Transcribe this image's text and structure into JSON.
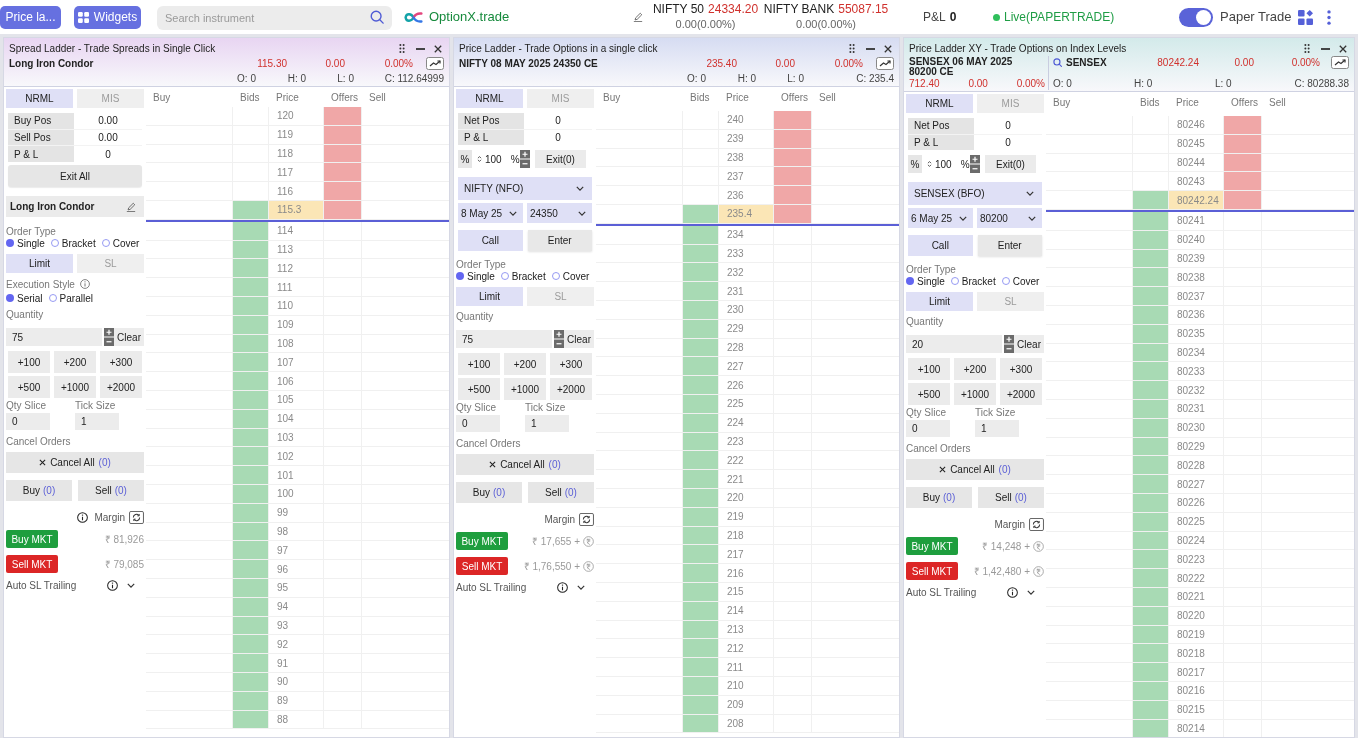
{
  "top_bar": {
    "menu_button": "Price la...",
    "widgets_button": "Widgets",
    "search": {
      "placeholder": "Search instrument"
    },
    "logo": "OptionX.trade",
    "indices": [
      {
        "name": "NIFTY 50",
        "value": "24334.20",
        "change": "0.00(0.00%)"
      },
      {
        "name": "NIFTY BANK",
        "value": "55087.15",
        "change": "0.00(0.00%)"
      }
    ],
    "pnl": {
      "label": "P&L",
      "value": "0"
    },
    "status": "Live(PAPERTRADE)",
    "paper_trade": {
      "label": "Paper Trade",
      "on": true
    }
  },
  "panels": [
    {
      "kind": "spread",
      "color": "#e8d5f2",
      "title": "Spread Ladder - Trade Spreads in Single Click",
      "quote": {
        "name": "Long Iron Condor",
        "ltp": "115.30",
        "change": "0.00",
        "change_pct": "0.00%"
      },
      "stats": [
        "O: 0",
        "H: 0",
        "L: 0",
        "C: 112.64999"
      ],
      "product_tabs": [
        {
          "label": "NRML",
          "selected": true
        },
        {
          "label": "MIS",
          "selected": false
        }
      ],
      "positions": [
        {
          "label": "Buy Pos",
          "value": "0.00"
        },
        {
          "label": "Sell Pos",
          "value": "0.00"
        },
        {
          "label": "P & L",
          "value": "0"
        }
      ],
      "exit_all": "Exit All",
      "strategy": "Long Iron Condor",
      "order_type": {
        "label": "Order Type",
        "options": [
          {
            "label": "Single",
            "selected": true
          },
          {
            "label": "Bracket",
            "selected": false
          },
          {
            "label": "Cover",
            "selected": false
          }
        ]
      },
      "price_tabs": [
        {
          "label": "Limit",
          "selected": true
        },
        {
          "label": "SL",
          "selected": false
        }
      ],
      "execution_style": {
        "label": "Execution Style",
        "options": [
          {
            "label": "Serial",
            "selected": true
          },
          {
            "label": "Parallel",
            "selected": false
          }
        ]
      },
      "quantity": {
        "label": "Quantity",
        "value": "75",
        "clear": "Clear"
      },
      "presets": [
        "+100",
        "+200",
        "+300",
        "+500",
        "+1000",
        "+2000"
      ],
      "qty_slice": {
        "label": "Qty Slice",
        "value": "0"
      },
      "tick_size": {
        "label": "Tick Size",
        "value": "1"
      },
      "cancel_orders": {
        "label": "Cancel Orders",
        "button": "Cancel All",
        "count": "(0)"
      },
      "order_counts": [
        {
          "label": "Buy",
          "count": "(0)"
        },
        {
          "label": "Sell",
          "count": "(0)"
        }
      ],
      "margin": "Margin",
      "market_orders": [
        {
          "kind": "buy",
          "label": "Buy MKT",
          "margin": "₹ 81,926"
        },
        {
          "kind": "sell",
          "label": "Sell MKT",
          "margin": "₹ 79,085"
        }
      ],
      "auto_sl": {
        "label": "Auto SL Trailing",
        "expanded": false
      },
      "ladder": {
        "columns": [
          "Buy",
          "Bids",
          "Price",
          "Offers",
          "Sell"
        ],
        "rows": [
          {
            "price": "120",
            "bid": false,
            "offer": true,
            "current": false
          },
          {
            "price": "119",
            "bid": false,
            "offer": true,
            "current": false
          },
          {
            "price": "118",
            "bid": false,
            "offer": true,
            "current": false
          },
          {
            "price": "117",
            "bid": false,
            "offer": true,
            "current": false
          },
          {
            "price": "116",
            "bid": false,
            "offer": true,
            "current": false
          },
          {
            "price": "115.3",
            "bid": true,
            "offer": true,
            "current": true
          },
          {
            "price": "114",
            "bid": true,
            "offer": false,
            "current": false
          },
          {
            "price": "113",
            "bid": true,
            "offer": false,
            "current": false
          },
          {
            "price": "112",
            "bid": true,
            "offer": false,
            "current": false
          },
          {
            "price": "111",
            "bid": true,
            "offer": false,
            "current": false
          },
          {
            "price": "110",
            "bid": true,
            "offer": false,
            "current": false
          },
          {
            "price": "109",
            "bid": true,
            "offer": false,
            "current": false
          },
          {
            "price": "108",
            "bid": true,
            "offer": false,
            "current": false
          },
          {
            "price": "107",
            "bid": true,
            "offer": false,
            "current": false
          },
          {
            "price": "106",
            "bid": true,
            "offer": false,
            "current": false
          },
          {
            "price": "105",
            "bid": true,
            "offer": false,
            "current": false
          },
          {
            "price": "104",
            "bid": true,
            "offer": false,
            "current": false
          },
          {
            "price": "103",
            "bid": true,
            "offer": false,
            "current": false
          },
          {
            "price": "102",
            "bid": true,
            "offer": false,
            "current": false
          },
          {
            "price": "101",
            "bid": true,
            "offer": false,
            "current": false
          },
          {
            "price": "100",
            "bid": true,
            "offer": false,
            "current": false
          },
          {
            "price": "99",
            "bid": true,
            "offer": false,
            "current": false
          },
          {
            "price": "98",
            "bid": true,
            "offer": false,
            "current": false
          },
          {
            "price": "97",
            "bid": true,
            "offer": false,
            "current": false
          },
          {
            "price": "96",
            "bid": true,
            "offer": false,
            "current": false
          },
          {
            "price": "95",
            "bid": true,
            "offer": false,
            "current": false
          },
          {
            "price": "94",
            "bid": true,
            "offer": false,
            "current": false
          },
          {
            "price": "93",
            "bid": true,
            "offer": false,
            "current": false
          },
          {
            "price": "92",
            "bid": true,
            "offer": false,
            "current": false
          },
          {
            "price": "91",
            "bid": true,
            "offer": false,
            "current": false
          },
          {
            "price": "90",
            "bid": true,
            "offer": false,
            "current": false
          },
          {
            "price": "89",
            "bid": true,
            "offer": false,
            "current": false
          },
          {
            "price": "88",
            "bid": true,
            "offer": false,
            "current": false
          }
        ]
      }
    },
    {
      "kind": "option",
      "color": "#d6dcf2",
      "title": "Price Ladder - Trade Options in a single click",
      "quote": {
        "name": "NIFTY 08 MAY 2025 24350 CE",
        "ltp": "235.40",
        "change": "0.00",
        "change_pct": "0.00%"
      },
      "stats": [
        "O: 0",
        "H: 0",
        "L: 0",
        "C: 235.4"
      ],
      "product_tabs": [
        {
          "label": "NRML",
          "selected": true
        },
        {
          "label": "MIS",
          "selected": false
        }
      ],
      "positions": [
        {
          "label": "Net Pos",
          "value": "0"
        },
        {
          "label": "P & L",
          "value": "0"
        }
      ],
      "exit_row": {
        "prefix": "%",
        "value": "100",
        "suffix": "%",
        "button": "Exit(0)"
      },
      "instrument": "NIFTY (NFO)",
      "expiry": "8 May 25",
      "strike": "24350",
      "call_button": "Call",
      "enter_button": "Enter",
      "order_type": {
        "label": "Order Type",
        "options": [
          {
            "label": "Single",
            "selected": true
          },
          {
            "label": "Bracket",
            "selected": false
          },
          {
            "label": "Cover",
            "selected": false
          }
        ]
      },
      "price_tabs": [
        {
          "label": "Limit",
          "selected": true
        },
        {
          "label": "SL",
          "selected": false
        }
      ],
      "quantity": {
        "label": "Quantity",
        "value": "75",
        "clear": "Clear"
      },
      "presets": [
        "+100",
        "+200",
        "+300",
        "+500",
        "+1000",
        "+2000"
      ],
      "qty_slice": {
        "label": "Qty Slice",
        "value": "0"
      },
      "tick_size": {
        "label": "Tick Size",
        "value": "1"
      },
      "cancel_orders": {
        "label": "Cancel Orders",
        "button": "Cancel All",
        "count": "(0)"
      },
      "order_counts": [
        {
          "label": "Buy",
          "count": "(0)"
        },
        {
          "label": "Sell",
          "count": "(0)"
        }
      ],
      "margin": "Margin",
      "market_orders": [
        {
          "kind": "buy",
          "label": "Buy MKT",
          "margin": "₹ 17,655 +"
        },
        {
          "kind": "sell",
          "label": "Sell MKT",
          "margin": "₹ 1,76,550 +"
        }
      ],
      "auto_sl": {
        "label": "Auto SL Trailing",
        "expanded": false
      },
      "ladder": {
        "columns": [
          "Buy",
          "Bids",
          "Price",
          "Offers",
          "Sell"
        ],
        "rows": [
          {
            "price": "240",
            "bid": false,
            "offer": true,
            "current": false
          },
          {
            "price": "239",
            "bid": false,
            "offer": true,
            "current": false
          },
          {
            "price": "238",
            "bid": false,
            "offer": true,
            "current": false
          },
          {
            "price": "237",
            "bid": false,
            "offer": true,
            "current": false
          },
          {
            "price": "236",
            "bid": false,
            "offer": true,
            "current": false
          },
          {
            "price": "235.4",
            "bid": true,
            "offer": true,
            "current": true
          },
          {
            "price": "234",
            "bid": true,
            "offer": false,
            "current": false
          },
          {
            "price": "233",
            "bid": true,
            "offer": false,
            "current": false
          },
          {
            "price": "232",
            "bid": true,
            "offer": false,
            "current": false
          },
          {
            "price": "231",
            "bid": true,
            "offer": false,
            "current": false
          },
          {
            "price": "230",
            "bid": true,
            "offer": false,
            "current": false
          },
          {
            "price": "229",
            "bid": true,
            "offer": false,
            "current": false
          },
          {
            "price": "228",
            "bid": true,
            "offer": false,
            "current": false
          },
          {
            "price": "227",
            "bid": true,
            "offer": false,
            "current": false
          },
          {
            "price": "226",
            "bid": true,
            "offer": false,
            "current": false
          },
          {
            "price": "225",
            "bid": true,
            "offer": false,
            "current": false
          },
          {
            "price": "224",
            "bid": true,
            "offer": false,
            "current": false
          },
          {
            "price": "223",
            "bid": true,
            "offer": false,
            "current": false
          },
          {
            "price": "222",
            "bid": true,
            "offer": false,
            "current": false
          },
          {
            "price": "221",
            "bid": true,
            "offer": false,
            "current": false
          },
          {
            "price": "220",
            "bid": true,
            "offer": false,
            "current": false
          },
          {
            "price": "219",
            "bid": true,
            "offer": false,
            "current": false
          },
          {
            "price": "218",
            "bid": true,
            "offer": false,
            "current": false
          },
          {
            "price": "217",
            "bid": true,
            "offer": false,
            "current": false
          },
          {
            "price": "216",
            "bid": true,
            "offer": false,
            "current": false
          },
          {
            "price": "215",
            "bid": true,
            "offer": false,
            "current": false
          },
          {
            "price": "214",
            "bid": true,
            "offer": false,
            "current": false
          },
          {
            "price": "213",
            "bid": true,
            "offer": false,
            "current": false
          },
          {
            "price": "212",
            "bid": true,
            "offer": false,
            "current": false
          },
          {
            "price": "211",
            "bid": true,
            "offer": false,
            "current": false
          },
          {
            "price": "210",
            "bid": true,
            "offer": false,
            "current": false
          },
          {
            "price": "209",
            "bid": true,
            "offer": false,
            "current": false
          },
          {
            "price": "208",
            "bid": true,
            "offer": false,
            "current": false
          }
        ]
      }
    },
    {
      "kind": "option_xy",
      "color": "#d3eaea",
      "title": "Price Ladder XY - Trade Options on Index Levels",
      "quote": {
        "name": "SENSEX 06 MAY 2025 80200 CE",
        "ltp": "712.40",
        "change": "0.00",
        "change_pct": "0.00%"
      },
      "underlying": {
        "name": "SENSEX",
        "ltp": "80242.24",
        "change": "0.00",
        "change_pct": "0.00%"
      },
      "stats": [
        "O: 0",
        "H: 0",
        "L: 0",
        "C: 80288.38"
      ],
      "product_tabs": [
        {
          "label": "NRML",
          "selected": true
        },
        {
          "label": "MIS",
          "selected": false
        }
      ],
      "positions": [
        {
          "label": "Net Pos",
          "value": "0"
        },
        {
          "label": "P & L",
          "value": "0"
        }
      ],
      "exit_row": {
        "prefix": "%",
        "value": "100",
        "suffix": "%",
        "button": "Exit(0)"
      },
      "instrument": "SENSEX (BFO)",
      "expiry": "6 May 25",
      "strike": "80200",
      "call_button": "Call",
      "enter_button": "Enter",
      "order_type": {
        "label": "Order Type",
        "options": [
          {
            "label": "Single",
            "selected": true
          },
          {
            "label": "Bracket",
            "selected": false
          },
          {
            "label": "Cover",
            "selected": false
          }
        ]
      },
      "price_tabs": [
        {
          "label": "Limit",
          "selected": true
        },
        {
          "label": "SL",
          "selected": false
        }
      ],
      "quantity": {
        "label": "Quantity",
        "value": "20",
        "clear": "Clear"
      },
      "presets": [
        "+100",
        "+200",
        "+300",
        "+500",
        "+1000",
        "+2000"
      ],
      "qty_slice": {
        "label": "Qty Slice",
        "value": "0"
      },
      "tick_size": {
        "label": "Tick Size",
        "value": "1"
      },
      "cancel_orders": {
        "label": "Cancel Orders",
        "button": "Cancel All",
        "count": "(0)"
      },
      "order_counts": [
        {
          "label": "Buy",
          "count": "(0)"
        },
        {
          "label": "Sell",
          "count": "(0)"
        }
      ],
      "margin": "Margin",
      "market_orders": [
        {
          "kind": "buy",
          "label": "Buy MKT",
          "margin": "₹ 14,248 +"
        },
        {
          "kind": "sell",
          "label": "Sell MKT",
          "margin": "₹ 1,42,480 +"
        }
      ],
      "auto_sl": {
        "label": "Auto SL Trailing",
        "expanded": false
      },
      "ladder": {
        "columns": [
          "Buy",
          "Bids",
          "Price",
          "Offers",
          "Sell"
        ],
        "rows": [
          {
            "price": "80246",
            "bid": false,
            "offer": true,
            "current": false
          },
          {
            "price": "80245",
            "bid": false,
            "offer": true,
            "current": false
          },
          {
            "price": "80244",
            "bid": false,
            "offer": true,
            "current": false
          },
          {
            "price": "80243",
            "bid": false,
            "offer": true,
            "current": false
          },
          {
            "price": "80242.24",
            "bid": true,
            "offer": true,
            "current": true
          },
          {
            "price": "80241",
            "bid": true,
            "offer": false,
            "current": false
          },
          {
            "price": "80240",
            "bid": true,
            "offer": false,
            "current": false
          },
          {
            "price": "80239",
            "bid": true,
            "offer": false,
            "current": false
          },
          {
            "price": "80238",
            "bid": true,
            "offer": false,
            "current": false
          },
          {
            "price": "80237",
            "bid": true,
            "offer": false,
            "current": false
          },
          {
            "price": "80236",
            "bid": true,
            "offer": false,
            "current": false
          },
          {
            "price": "80235",
            "bid": true,
            "offer": false,
            "current": false
          },
          {
            "price": "80234",
            "bid": true,
            "offer": false,
            "current": false
          },
          {
            "price": "80233",
            "bid": true,
            "offer": false,
            "current": false
          },
          {
            "price": "80232",
            "bid": true,
            "offer": false,
            "current": false
          },
          {
            "price": "80231",
            "bid": true,
            "offer": false,
            "current": false
          },
          {
            "price": "80230",
            "bid": true,
            "offer": false,
            "current": false
          },
          {
            "price": "80229",
            "bid": true,
            "offer": false,
            "current": false
          },
          {
            "price": "80228",
            "bid": true,
            "offer": false,
            "current": false
          },
          {
            "price": "80227",
            "bid": true,
            "offer": false,
            "current": false
          },
          {
            "price": "80226",
            "bid": true,
            "offer": false,
            "current": false
          },
          {
            "price": "80225",
            "bid": true,
            "offer": false,
            "current": false
          },
          {
            "price": "80224",
            "bid": true,
            "offer": false,
            "current": false
          },
          {
            "price": "80223",
            "bid": true,
            "offer": false,
            "current": false
          },
          {
            "price": "80222",
            "bid": true,
            "offer": false,
            "current": false
          },
          {
            "price": "80221",
            "bid": true,
            "offer": false,
            "current": false
          },
          {
            "price": "80220",
            "bid": true,
            "offer": false,
            "current": false
          },
          {
            "price": "80219",
            "bid": true,
            "offer": false,
            "current": false
          },
          {
            "price": "80218",
            "bid": true,
            "offer": false,
            "current": false
          },
          {
            "price": "80217",
            "bid": true,
            "offer": false,
            "current": false
          },
          {
            "price": "80216",
            "bid": true,
            "offer": false,
            "current": false
          },
          {
            "price": "80215",
            "bid": true,
            "offer": false,
            "current": false
          },
          {
            "price": "80214",
            "bid": true,
            "offer": false,
            "current": false
          }
        ]
      }
    }
  ]
}
